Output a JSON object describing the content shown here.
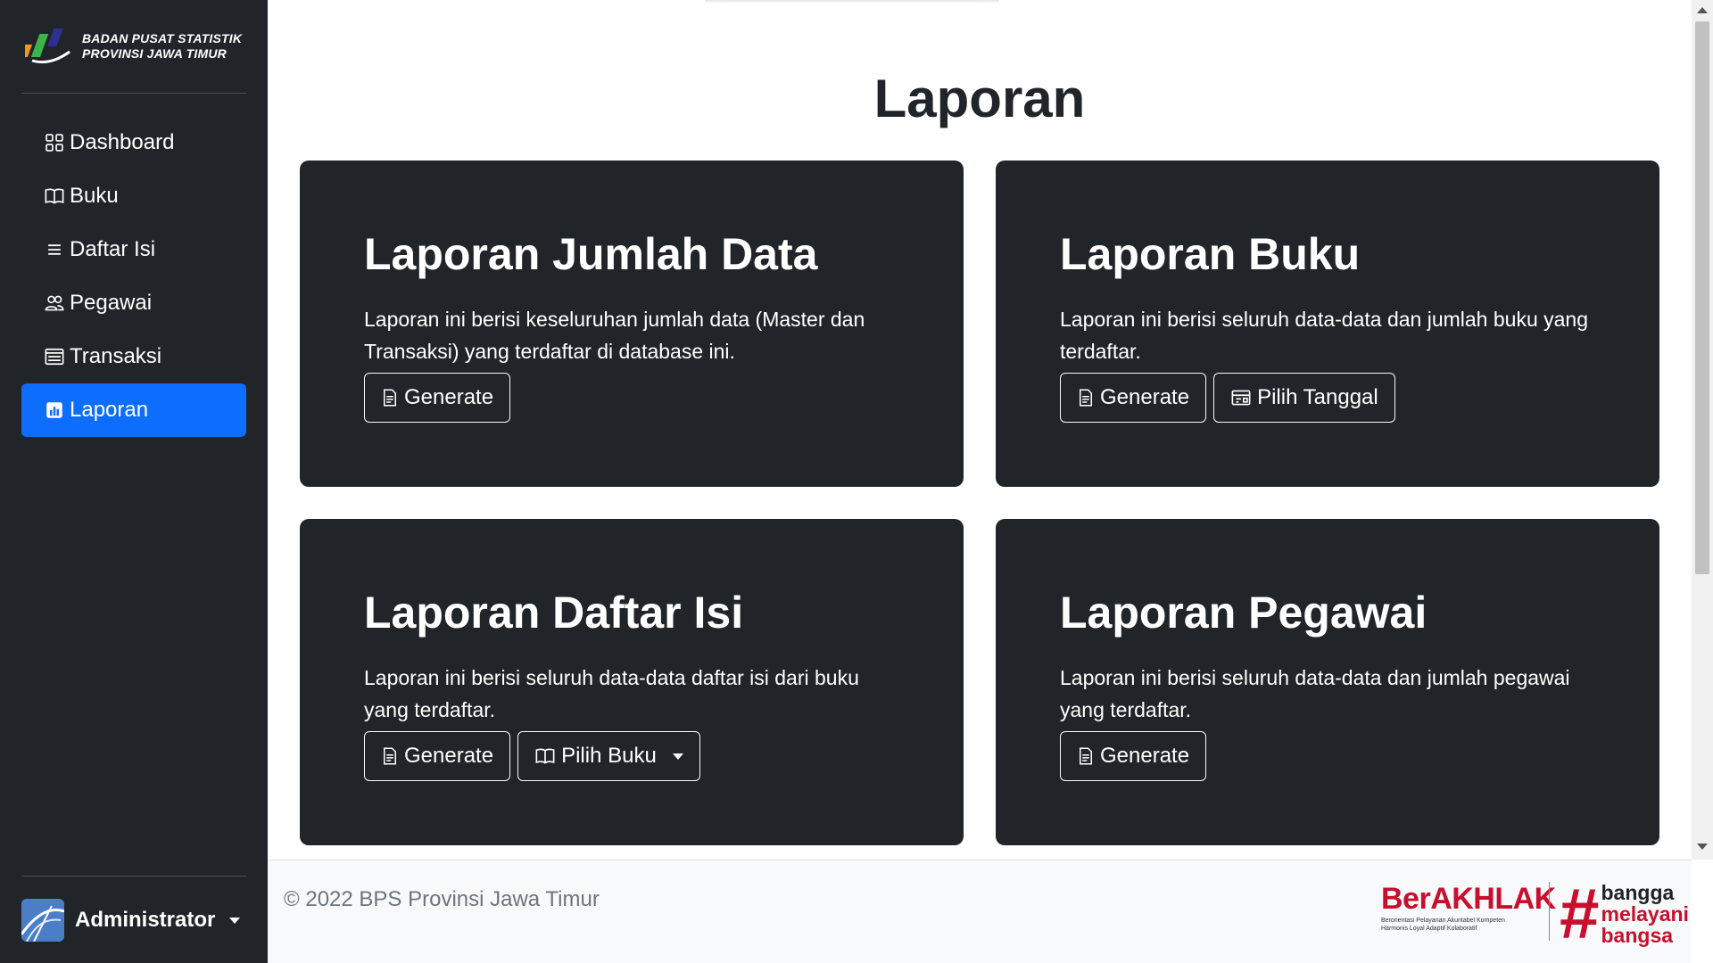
{
  "brand": {
    "line1": "BADAN PUSAT STATISTIK",
    "line2": "PROVINSI JAWA TIMUR"
  },
  "sidebar": {
    "items": [
      {
        "label": "Dashboard",
        "icon": "grid-icon"
      },
      {
        "label": "Buku",
        "icon": "book-icon"
      },
      {
        "label": "Daftar Isi",
        "icon": "list-icon"
      },
      {
        "label": "Pegawai",
        "icon": "people-icon"
      },
      {
        "label": "Transaksi",
        "icon": "card-list-icon"
      },
      {
        "label": "Laporan",
        "icon": "bar-chart-icon",
        "active": true
      }
    ]
  },
  "user": {
    "name": "Administrator"
  },
  "page": {
    "title": "Laporan"
  },
  "cards": [
    {
      "title": "Laporan Jumlah Data",
      "desc": "Laporan ini berisi keseluruhan jumlah data (Master dan Transaksi) yang terdaftar di database ini.",
      "buttons": [
        "Generate"
      ]
    },
    {
      "title": "Laporan Buku",
      "desc": "Laporan ini berisi seluruh data-data dan jumlah buku yang terdaftar.",
      "buttons": [
        "Generate",
        "Pilih Tanggal"
      ]
    },
    {
      "title": "Laporan Daftar Isi",
      "desc": "Laporan ini berisi seluruh data-data daftar isi dari buku yang terdaftar.",
      "buttons": [
        "Generate",
        "Pilih Buku"
      ]
    },
    {
      "title": "Laporan Pegawai",
      "desc": "Laporan ini berisi seluruh data-data dan jumlah pegawai yang terdaftar.",
      "buttons": [
        "Generate"
      ]
    }
  ],
  "footer": {
    "copyright": "© 2022 BPS Provinsi Jawa Timur",
    "berakhlak_title": "BerAKHLAK",
    "berakhlak_sub1": "Berorientasi Pelayanan Akuntabel Kompeten",
    "berakhlak_sub2": "Harmonis Loyal Adaptif Kolaboratif",
    "bangga_1": "bangga",
    "bangga_2": "melayani",
    "bangga_3": "bangsa"
  },
  "colors": {
    "sidebar_bg": "#212529",
    "active": "#0d6efd",
    "card_bg": "#212529",
    "brand_red": "#c8102e"
  }
}
